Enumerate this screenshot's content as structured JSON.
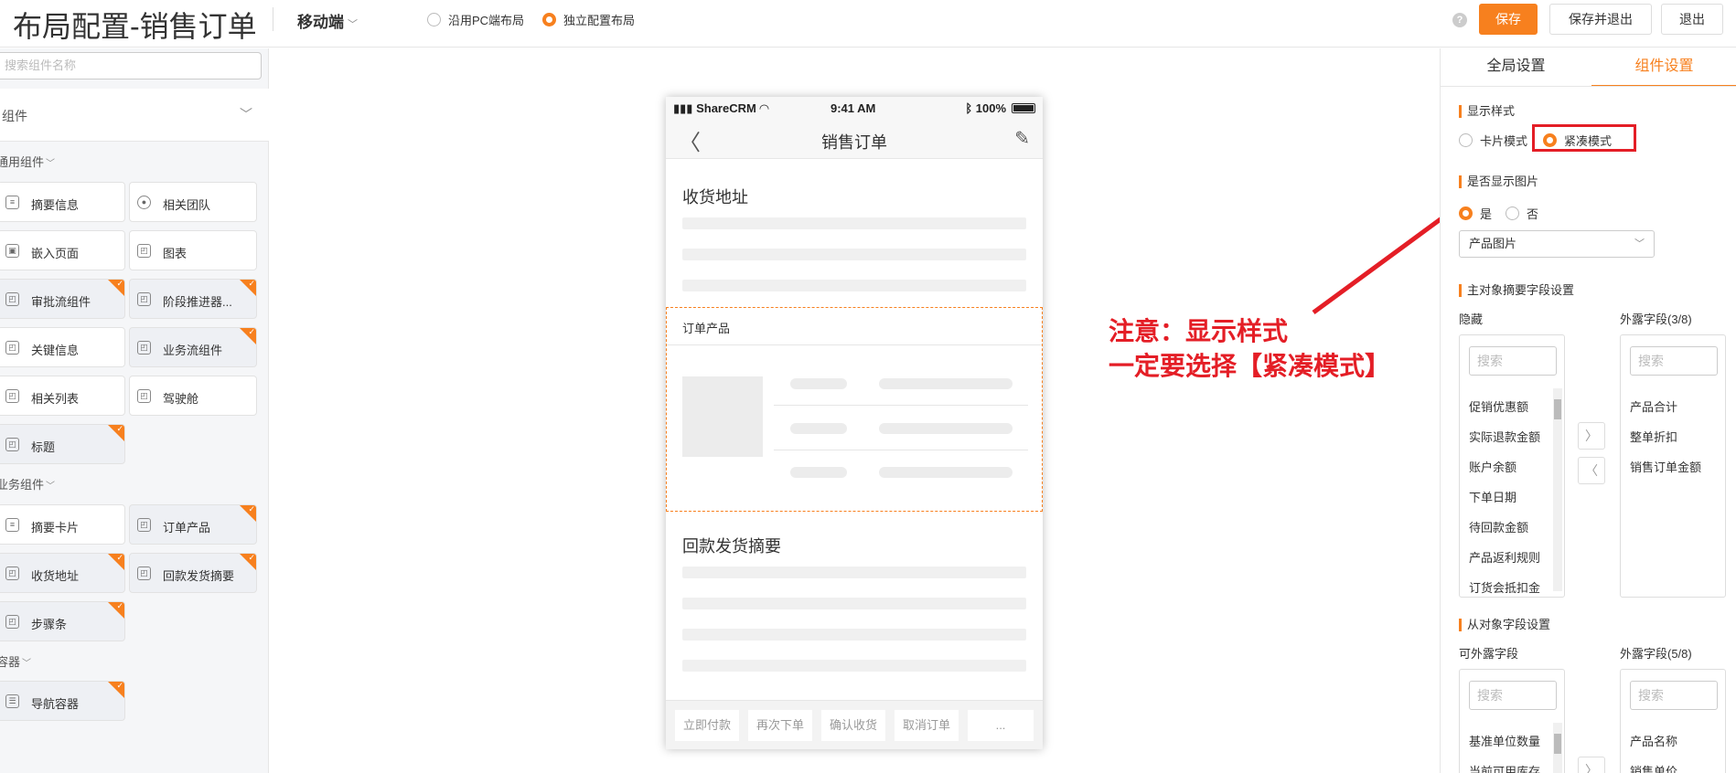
{
  "header": {
    "title": "布局配置-销售订单",
    "device": "移动端",
    "layout_options": [
      "沿用PC端布局",
      "独立配置布局"
    ],
    "help": "?",
    "save": "保存",
    "save_exit": "保存并退出",
    "exit": "退出"
  },
  "left": {
    "search_placeholder": "搜索组件名称",
    "components_label": "组件",
    "groups": {
      "common": "通用组件",
      "business": "业务组件",
      "container": "容器"
    },
    "tiles": {
      "summary_info": "摘要信息",
      "related_team": "相关团队",
      "embedded_page": "嵌入页面",
      "chart": "图表",
      "approval_flow": "审批流组件",
      "stage_pusher": "阶段推进器...",
      "key_info": "关键信息",
      "business_flow": "业务流组件",
      "related_list": "相关列表",
      "cockpit": "驾驶舱",
      "heading": "标题",
      "summary_card": "摘要卡片",
      "order_products": "订单产品",
      "shipping_address": "收货地址",
      "payment_summary": "回款发货摘要",
      "steps": "步骤条",
      "nav_container": "导航容器"
    }
  },
  "phone": {
    "carrier": "ShareCRM",
    "time": "9:41 AM",
    "battery": "100%",
    "title": "销售订单",
    "section1": "收货地址",
    "order_products": "订单产品",
    "section3": "回款发货摘要",
    "actions": [
      "立即付款",
      "再次下单",
      "确认收货",
      "取消订单",
      "..."
    ]
  },
  "note": {
    "line1": "注意：显示样式",
    "line2": "一定要选择【紧凑模式】"
  },
  "right": {
    "tabs": [
      "全局设置",
      "组件设置"
    ],
    "display_style_label": "显示样式",
    "card_mode": "卡片模式",
    "compact_mode": "紧凑模式",
    "show_image_label": "是否显示图片",
    "yes": "是",
    "no": "否",
    "image_field": "产品图片",
    "main_summary_label": "主对象摘要字段设置",
    "hidden_label": "隐藏",
    "exposed_label": "外露字段(3/8)",
    "search": "搜索",
    "hidden_items": [
      "促销优惠额",
      "实际退款金额",
      "账户余额",
      "下单日期",
      "待回款金额",
      "产品返利规则",
      "订货会抵扣金"
    ],
    "exposed_items": [
      "产品合计",
      "整单折扣",
      "销售订单金额"
    ],
    "sub_field_label": "从对象字段设置",
    "available_label": "可外露字段",
    "exposed2_label": "外露字段(5/8)",
    "available_items": [
      "基准单位数量",
      "当前可用库存"
    ],
    "exposed2_items": [
      "产品名称",
      "销售单价"
    ]
  },
  "colors": {
    "accent": "#f7801e",
    "annotation": "#e41e26"
  }
}
